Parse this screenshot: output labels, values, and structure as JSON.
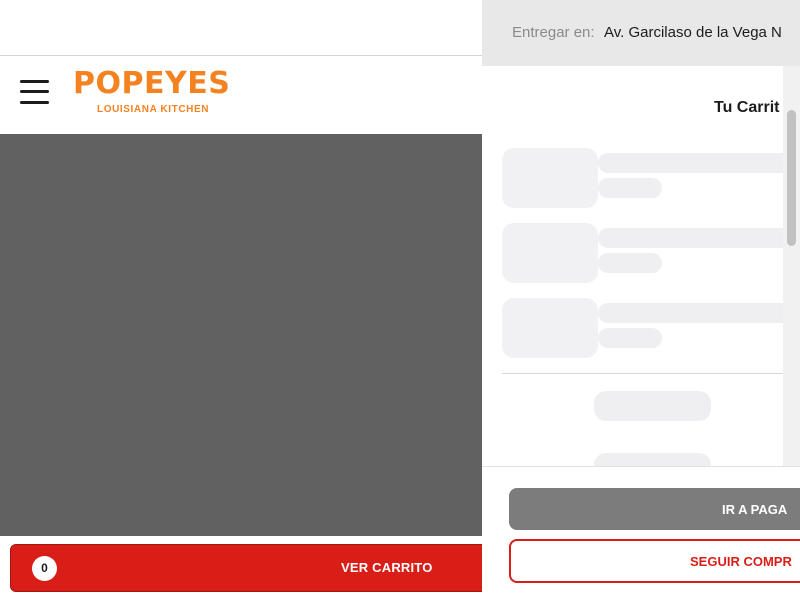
{
  "brand": {
    "name": "POPEYES",
    "tagline": "LOUISIANA KITCHEN",
    "color": "#f58220"
  },
  "bottom_bar": {
    "cart_count": "0",
    "cart_label": "VER CARRITO",
    "color": "#d91e18"
  },
  "drawer": {
    "deliver_prefix": "Entregar en:",
    "deliver_address": "Av. Garcilaso de la Vega N",
    "title": "Tu Carrit",
    "pay_button": "IR A PAGA",
    "continue_button": "SEGUIR COMPR"
  },
  "icons": {
    "menu": "hamburger-menu-icon"
  }
}
